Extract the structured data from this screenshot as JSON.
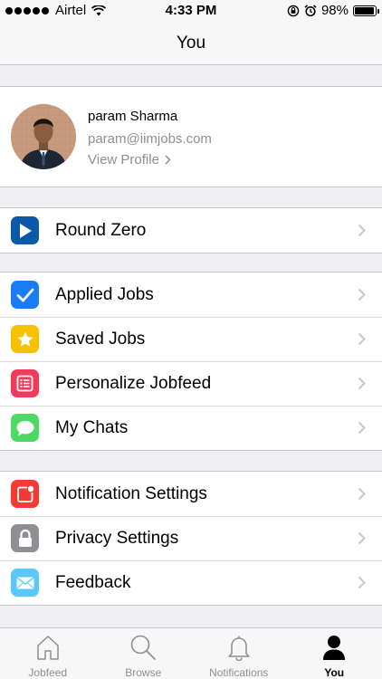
{
  "status_bar": {
    "carrier": "Airtel",
    "time": "4:33 PM",
    "battery": "98%"
  },
  "nav": {
    "title": "You"
  },
  "profile": {
    "name": "param Sharma",
    "email": "param@iimjobs.com",
    "view_profile": "View Profile"
  },
  "groups": [
    {
      "items": [
        {
          "label": "Round Zero",
          "icon": "play-icon",
          "color": "#0b5aa8"
        }
      ]
    },
    {
      "items": [
        {
          "label": "Applied Jobs",
          "icon": "checkmark-icon",
          "color": "#1a7cf2"
        },
        {
          "label": "Saved Jobs",
          "icon": "star-icon",
          "color": "#f7c000"
        },
        {
          "label": "Personalize Jobfeed",
          "icon": "list-icon",
          "color": "#f03b5a"
        },
        {
          "label": "My Chats",
          "icon": "chat-bubble-icon",
          "color": "#4cd964"
        }
      ]
    },
    {
      "items": [
        {
          "label": "Notification Settings",
          "icon": "notification-badge-icon",
          "color": "#f23b35"
        },
        {
          "label": "Privacy Settings",
          "icon": "lock-icon",
          "color": "#8e8e93"
        },
        {
          "label": "Feedback",
          "icon": "envelope-icon",
          "color": "#5ac8fa"
        }
      ]
    }
  ],
  "tabs": [
    {
      "label": "Jobfeed",
      "icon": "home-icon",
      "active": false
    },
    {
      "label": "Browse",
      "icon": "search-icon",
      "active": false
    },
    {
      "label": "Notifications",
      "icon": "bell-icon",
      "active": false
    },
    {
      "label": "You",
      "icon": "person-icon",
      "active": true
    }
  ]
}
